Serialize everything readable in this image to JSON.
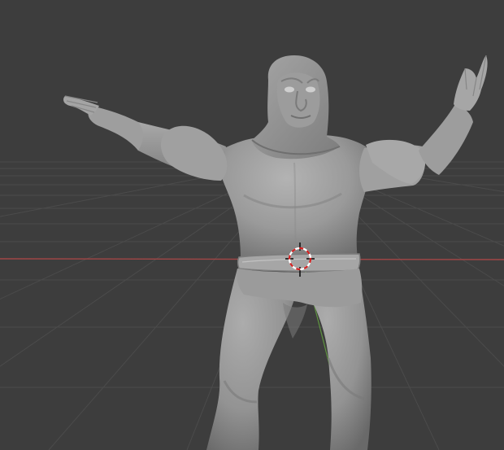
{
  "app": {
    "name": "3D viewport",
    "mode": "solid-shading"
  },
  "viewport": {
    "background_color": "#3d3d3d",
    "grid_color": "#4a4a4a",
    "x_axis_color": "#b44a4a",
    "y_axis_color": "#6aa14a",
    "model_color": "#9a9a9a",
    "cursor_ring_colors": [
      "#ffffff",
      "#d21f1f"
    ]
  },
  "scene": {
    "object": "humanoid-character-mesh",
    "pose": "arms-raised",
    "features": [
      "hood",
      "face",
      "torso",
      "belt",
      "legs",
      "hands"
    ]
  },
  "cursor": {
    "icon": "3d-cursor-icon"
  }
}
